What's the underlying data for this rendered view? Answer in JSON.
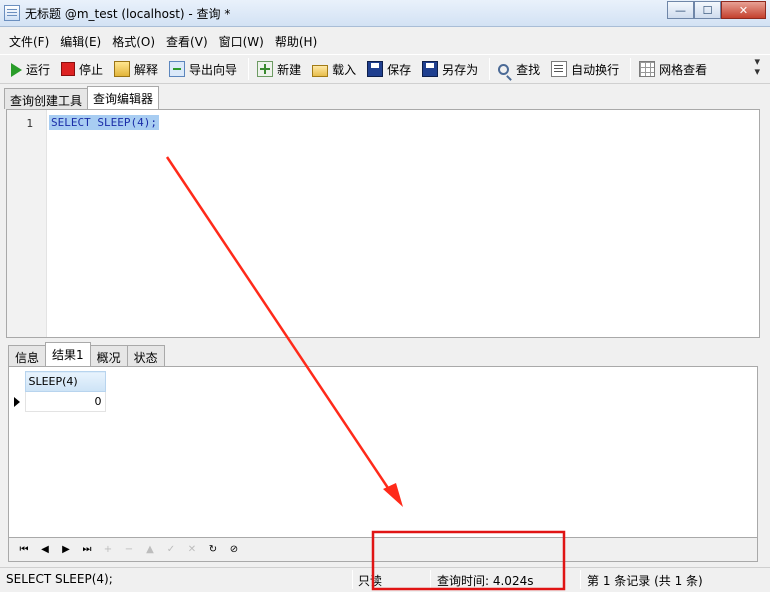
{
  "window": {
    "title": "无标题 @m_test (localhost) - 查询 *",
    "minimize": "—",
    "maximize": "☐",
    "close": "✕"
  },
  "menu": [
    "文件(F)",
    "编辑(E)",
    "格式(O)",
    "查看(V)",
    "窗口(W)",
    "帮助(H)"
  ],
  "toolbar": {
    "run": "运行",
    "stop": "停止",
    "explain": "解释",
    "export_wizard": "导出向导",
    "new": "新建",
    "load": "载入",
    "save": "保存",
    "save_as": "另存为",
    "find": "查找",
    "word_wrap": "自动换行",
    "grid_view": "网格查看",
    "more": "▾"
  },
  "editor_tabs": [
    "查询创建工具",
    "查询编辑器"
  ],
  "editor": {
    "line_number": "1",
    "code": "SELECT SLEEP(4);"
  },
  "result_tabs": [
    "信息",
    "结果1",
    "概况",
    "状态"
  ],
  "result_grid": {
    "columns": [
      "SLEEP(4)"
    ],
    "rows": [
      [
        "0"
      ]
    ]
  },
  "navigator": [
    "⏮",
    "◀",
    "▶",
    "⏭",
    "+",
    "−",
    "▲",
    "✓",
    "✕",
    "↻",
    "⊘"
  ],
  "status": {
    "sql": "SELECT SLEEP(4);",
    "mode": "只读",
    "query_time": "查询时间: 4.024s",
    "records": "第 1 条记录 (共 1 条)"
  },
  "annotation_colors": {
    "arrow": "#ff2a1a",
    "box": "#e01414"
  }
}
